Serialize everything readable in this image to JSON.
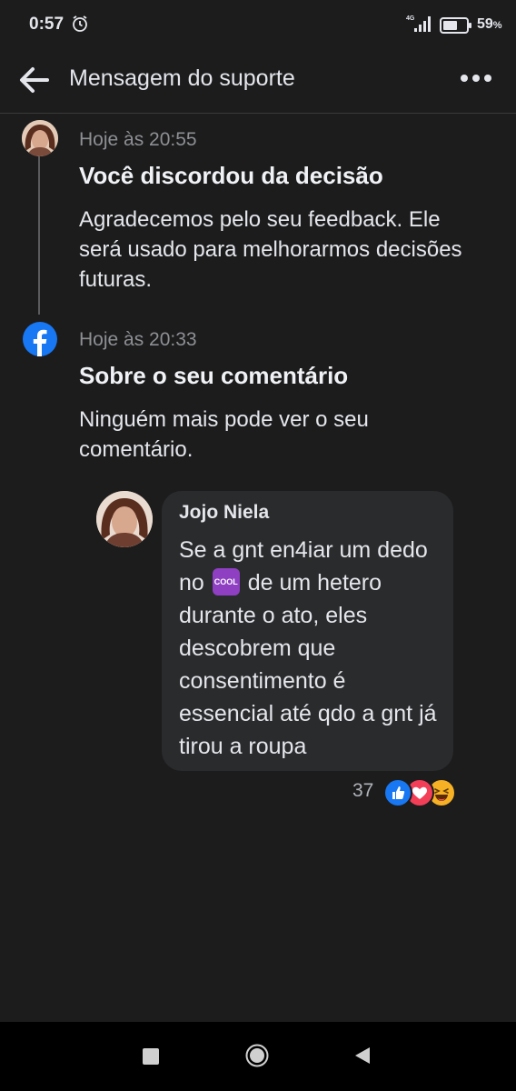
{
  "status_bar": {
    "time": "0:57",
    "network": "4G",
    "battery_percent": "59",
    "battery_unit": "%"
  },
  "header": {
    "title": "Mensagem do suporte",
    "back_icon": "arrow-left-icon",
    "more_icon": "more-horizontal-icon"
  },
  "messages": [
    {
      "time": "Hoje às 20:55",
      "title": "Você discordou da decisão",
      "body": "Agradecemos pelo seu feedback. Ele será usado para melhorarmos decisões futuras."
    },
    {
      "time": "Hoje às 20:33",
      "title": "Sobre o seu comentário",
      "body": "Ninguém mais pode ver o seu comentário."
    }
  ],
  "comment": {
    "author": "Jojo Niela",
    "text_before_emoji": "Se a gnt en4iar um dedo no",
    "emoji_label": "COOL",
    "text_after_emoji": "de um hetero durante o ato, eles descobrem que consentimento é essencial até qdo a gnt já tirou a roupa",
    "reaction_count": "37",
    "reactions": [
      "like",
      "love",
      "haha"
    ]
  },
  "colors": {
    "background": "#1c1c1d",
    "bubble": "#2a2b2d",
    "facebook_blue": "#1877f2",
    "love_red": "#f33e58",
    "haha_yellow": "#f7b125"
  }
}
